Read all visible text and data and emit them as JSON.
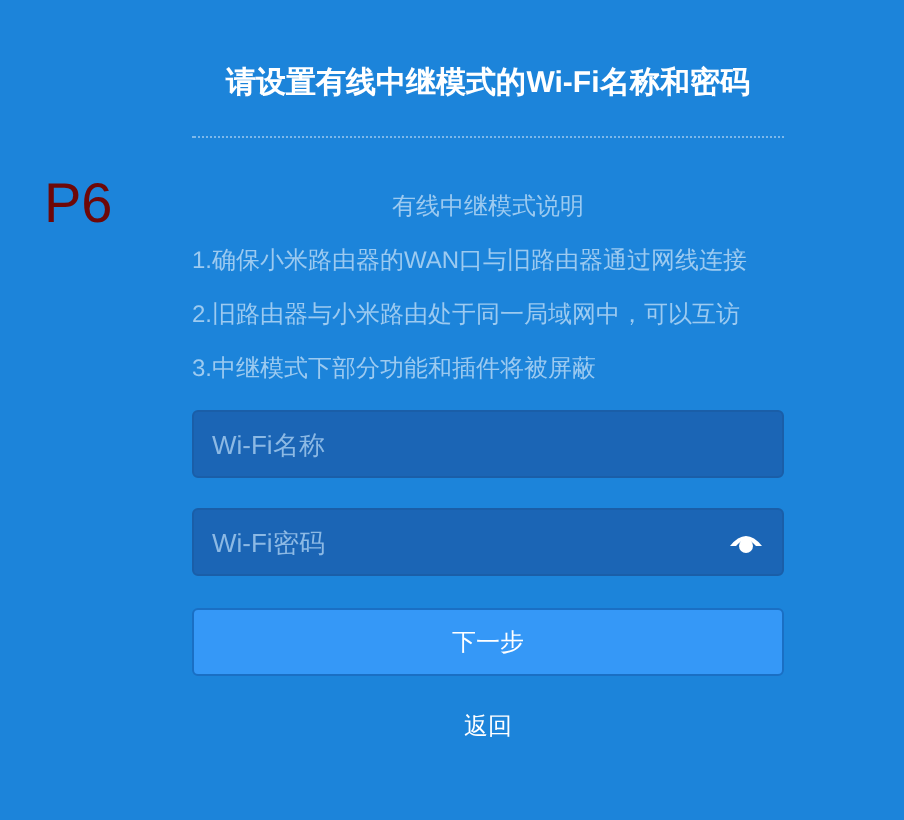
{
  "annotation": "P6",
  "title": "请设置有线中继模式的Wi-Fi名称和密码",
  "notes": {
    "heading": "有线中继模式说明",
    "items": [
      "1.确保小米路由器的WAN口与旧路由器通过网线连接",
      "2.旧路由器与小米路由处于同一局域网中，可以互访",
      "3.中继模式下部分功能和插件将被屏蔽"
    ]
  },
  "fields": [
    {
      "kind": "text",
      "placeholder": "Wi-Fi名称"
    },
    {
      "kind": "password",
      "placeholder": "Wi-Fi密码"
    }
  ],
  "primary_button": "下一步",
  "back_link": "返回"
}
